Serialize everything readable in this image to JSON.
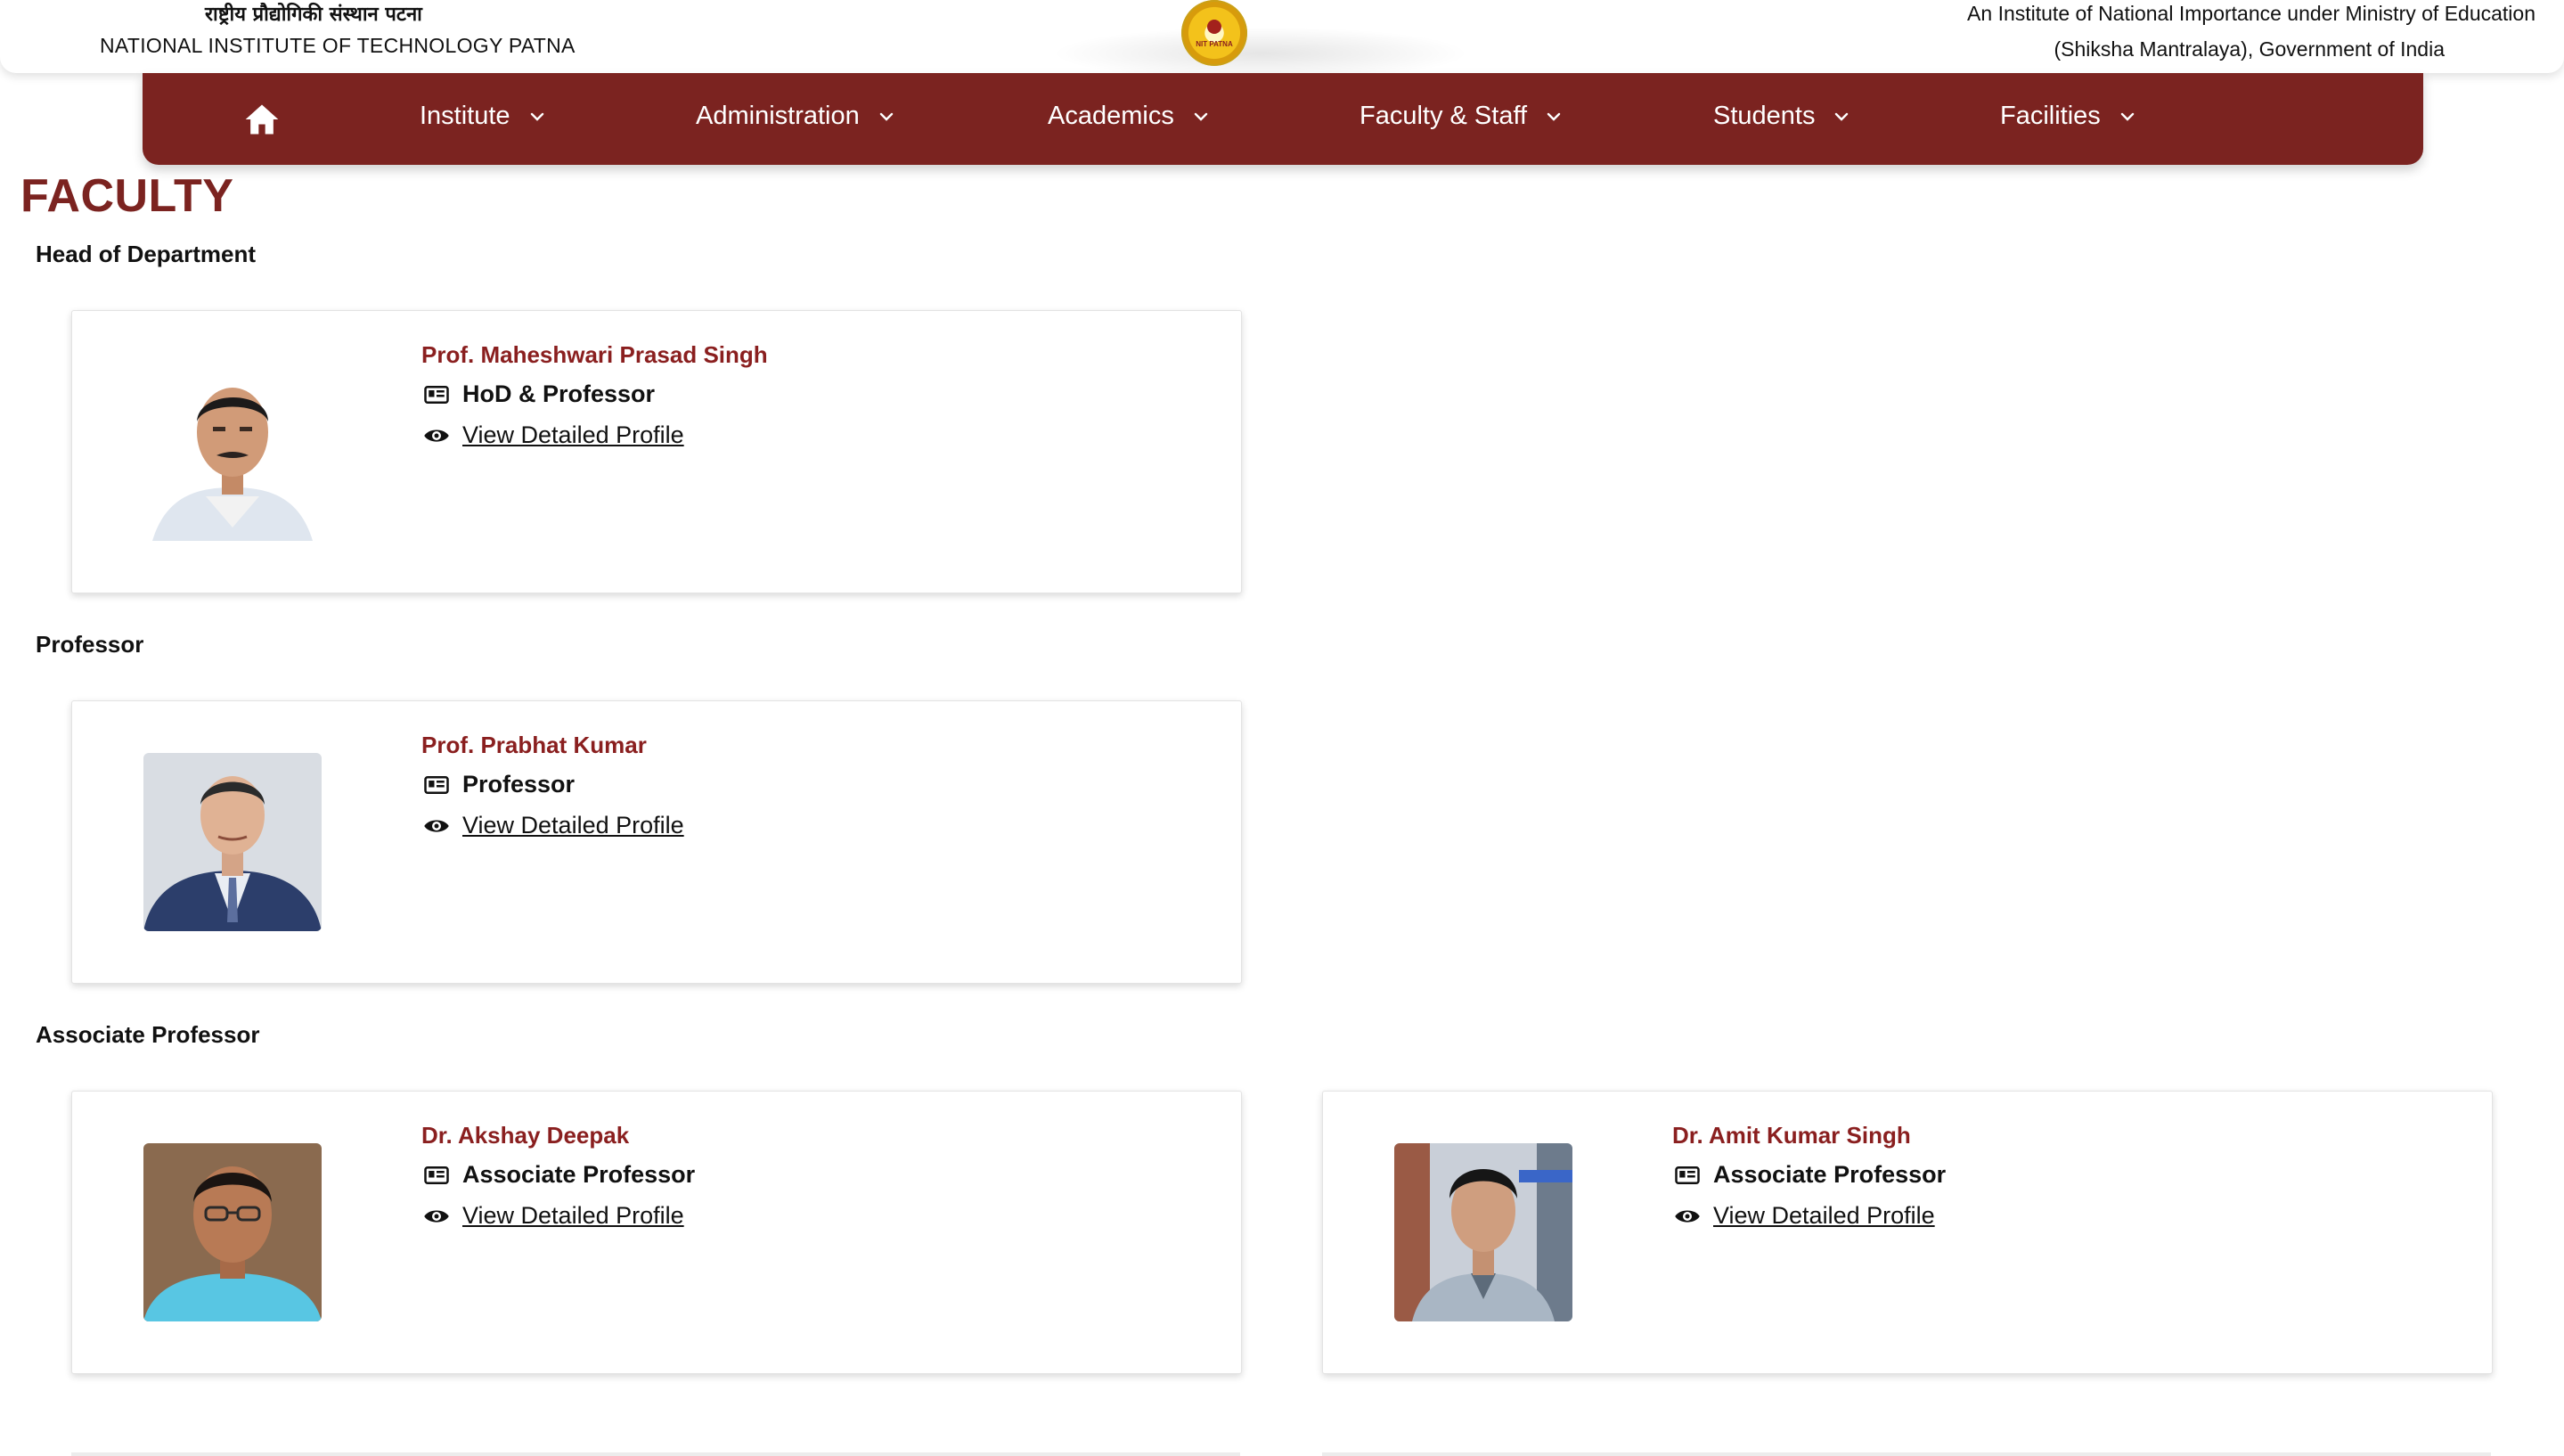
{
  "header": {
    "hindi_name": "राष्ट्रीय प्रौद्योगिकी संस्थान पटना",
    "english_name": "NATIONAL INSTITUTE OF TECHNOLOGY PATNA",
    "logo_text": "NIT PATNA",
    "tagline_line1": "An Institute of National Importance under Ministry of Education",
    "tagline_line2": "(Shiksha Mantralaya), Government of India"
  },
  "nav": {
    "home_icon": "home-icon",
    "items": [
      {
        "label": "Institute"
      },
      {
        "label": "Administration"
      },
      {
        "label": "Academics"
      },
      {
        "label": "Faculty & Staff"
      },
      {
        "label": "Students"
      },
      {
        "label": "Facilities"
      }
    ]
  },
  "page": {
    "title": "FACULTY",
    "sections": [
      {
        "label": "Head of Department",
        "members": [
          {
            "name": "Prof. Maheshwari Prasad Singh",
            "designation": "HoD & Professor",
            "link": "View Detailed Profile"
          }
        ]
      },
      {
        "label": "Professor",
        "members": [
          {
            "name": "Prof. Prabhat Kumar",
            "designation": "Professor",
            "link": "View Detailed Profile"
          }
        ]
      },
      {
        "label": "Associate Professor",
        "members": [
          {
            "name": "Dr. Akshay Deepak",
            "designation": "Associate Professor",
            "link": "View Detailed Profile"
          },
          {
            "name": "Dr. Amit Kumar Singh",
            "designation": "Associate Professor",
            "link": "View Detailed Profile"
          }
        ]
      }
    ]
  },
  "colors": {
    "brand_maroon": "#7b2320",
    "name_red": "#8a1f1f"
  },
  "icons": {
    "designation": "id-card-icon",
    "profile": "eye-icon"
  }
}
